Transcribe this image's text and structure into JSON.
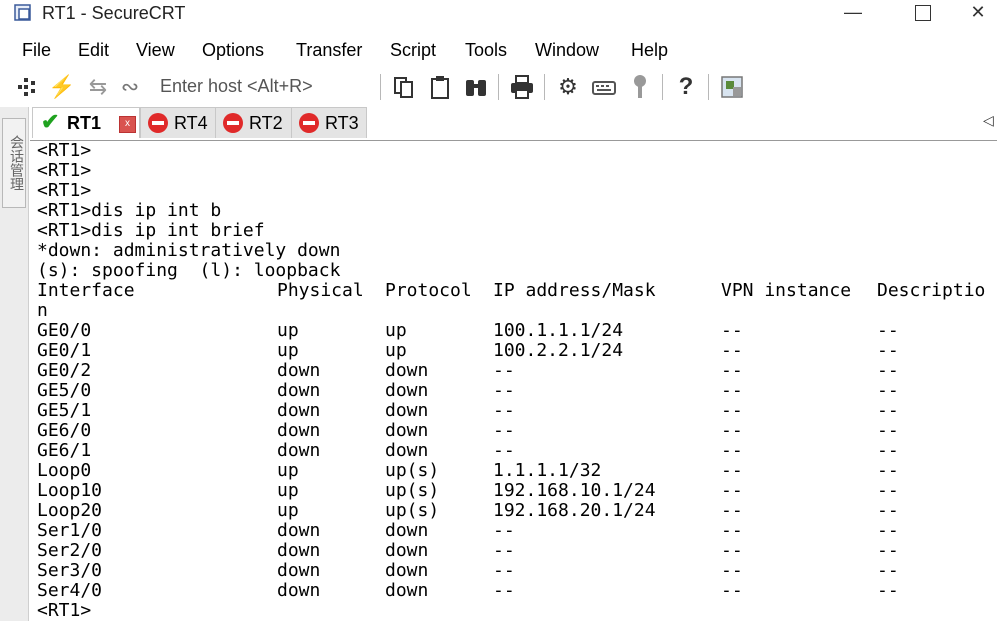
{
  "window": {
    "title": "RT1 - SecureCRT"
  },
  "menu": [
    "File",
    "Edit",
    "View",
    "Options",
    "Transfer",
    "Script",
    "Tools",
    "Window",
    "Help"
  ],
  "toolbar": {
    "enter_host": "Enter host <Alt+R>",
    "help_label": "?"
  },
  "side_panel": {
    "label": "会话管理"
  },
  "tabs": [
    {
      "label": "RT1",
      "status": "connected",
      "close": "x"
    },
    {
      "label": "RT4",
      "status": "disconnected"
    },
    {
      "label": "RT2",
      "status": "disconnected"
    },
    {
      "label": "RT3",
      "status": "disconnected"
    }
  ],
  "terminal": {
    "pre_lines": [
      "<RT1>",
      "<RT1>",
      "<RT1>",
      "<RT1>dis ip int b",
      "<RT1>dis ip int brief",
      "*down: administratively down",
      "(s): spoofing  (l): loopback"
    ],
    "headers": [
      "Interface",
      "Physical",
      "Protocol",
      "IP address/Mask",
      "VPN instance",
      "Descriptio"
    ],
    "header_wrap": "n",
    "rows": [
      [
        "GE0/0",
        "up",
        "up",
        "100.1.1.1/24",
        "--",
        "--"
      ],
      [
        "GE0/1",
        "up",
        "up",
        "100.2.2.1/24",
        "--",
        "--"
      ],
      [
        "GE0/2",
        "down",
        "down",
        "--",
        "--",
        "--"
      ],
      [
        "GE5/0",
        "down",
        "down",
        "--",
        "--",
        "--"
      ],
      [
        "GE5/1",
        "down",
        "down",
        "--",
        "--",
        "--"
      ],
      [
        "GE6/0",
        "down",
        "down",
        "--",
        "--",
        "--"
      ],
      [
        "GE6/1",
        "down",
        "down",
        "--",
        "--",
        "--"
      ],
      [
        "Loop0",
        "up",
        "up(s)",
        "1.1.1.1/32",
        "--",
        "--"
      ],
      [
        "Loop10",
        "up",
        "up(s)",
        "192.168.10.1/24",
        "--",
        "--"
      ],
      [
        "Loop20",
        "up",
        "up(s)",
        "192.168.20.1/24",
        "--",
        "--"
      ],
      [
        "Ser1/0",
        "down",
        "down",
        "--",
        "--",
        "--"
      ],
      [
        "Ser2/0",
        "down",
        "down",
        "--",
        "--",
        "--"
      ],
      [
        "Ser3/0",
        "down",
        "down",
        "--",
        "--",
        "--"
      ],
      [
        "Ser4/0",
        "down",
        "down",
        "--",
        "--",
        "--"
      ]
    ],
    "prompt": "<RT1>"
  }
}
